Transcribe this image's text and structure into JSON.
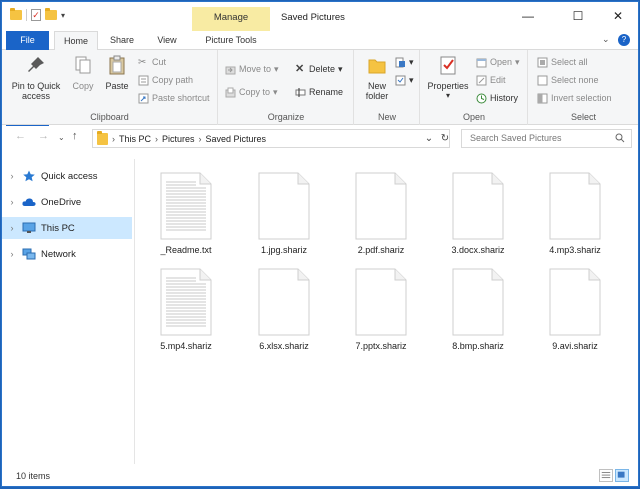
{
  "window": {
    "title": "Saved Pictures",
    "context_tab": "Manage"
  },
  "tabs": {
    "file": "File",
    "home": "Home",
    "share": "Share",
    "view": "View",
    "picture_tools": "Picture Tools"
  },
  "ribbon": {
    "clipboard": {
      "label": "Clipboard",
      "pin": "Pin to Quick access",
      "copy": "Copy",
      "paste": "Paste",
      "cut": "Cut",
      "copy_path": "Copy path",
      "paste_shortcut": "Paste shortcut"
    },
    "organize": {
      "label": "Organize",
      "move_to": "Move to",
      "copy_to": "Copy to",
      "delete": "Delete",
      "rename": "Rename"
    },
    "new": {
      "label": "New",
      "new_folder": "New folder"
    },
    "open": {
      "label": "Open",
      "properties": "Properties",
      "open": "Open",
      "edit": "Edit",
      "history": "History"
    },
    "select": {
      "label": "Select",
      "select_all": "Select all",
      "select_none": "Select none",
      "invert": "Invert selection"
    }
  },
  "address": {
    "crumbs": [
      "This PC",
      "Pictures",
      "Saved Pictures"
    ],
    "search_placeholder": "Search Saved Pictures"
  },
  "nav": [
    {
      "label": "Quick access",
      "icon": "star-icon",
      "selected": false
    },
    {
      "label": "OneDrive",
      "icon": "cloud-icon",
      "selected": false
    },
    {
      "label": "This PC",
      "icon": "monitor-icon",
      "selected": true
    },
    {
      "label": "Network",
      "icon": "network-icon",
      "selected": false
    }
  ],
  "files": [
    {
      "name": "_Readme.txt",
      "type": "text"
    },
    {
      "name": "1.jpg.shariz",
      "type": "blank"
    },
    {
      "name": "2.pdf.shariz",
      "type": "blank"
    },
    {
      "name": "3.docx.shariz",
      "type": "blank"
    },
    {
      "name": "4.mp3.shariz",
      "type": "blank"
    },
    {
      "name": "5.mp4.shariz",
      "type": "text"
    },
    {
      "name": "6.xlsx.shariz",
      "type": "blank"
    },
    {
      "name": "7.pptx.shariz",
      "type": "blank"
    },
    {
      "name": "8.bmp.shariz",
      "type": "blank"
    },
    {
      "name": "9.avi.shariz",
      "type": "blank"
    }
  ],
  "status": {
    "item_count": "10 items"
  },
  "colors": {
    "accent": "#1a64c8",
    "selection": "#cce8ff",
    "context_tab": "#f8eba3",
    "folder": "#f5c342"
  }
}
